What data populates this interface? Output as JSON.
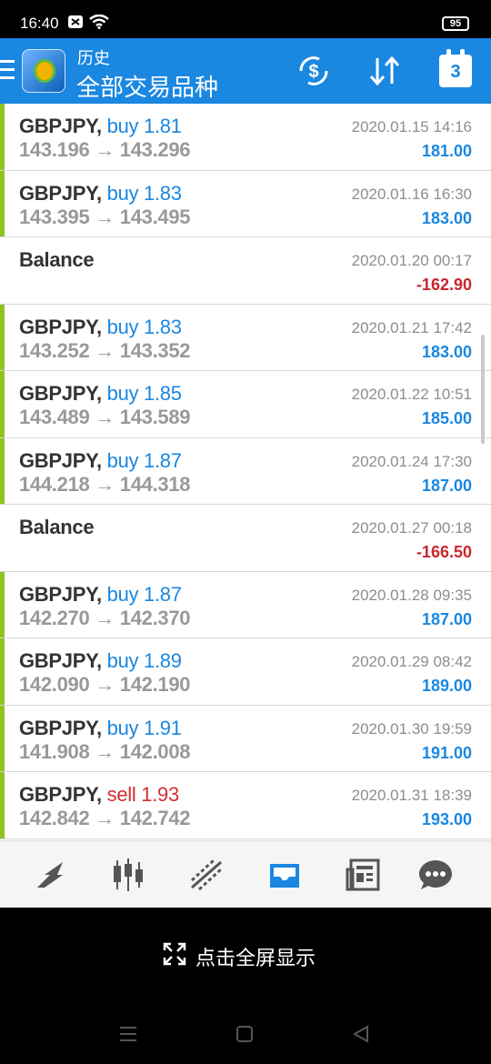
{
  "status_bar": {
    "time": "16:40",
    "battery": "95"
  },
  "header": {
    "subtitle": "历史",
    "title": "全部交易品种",
    "calendar_day": "3"
  },
  "rows": [
    {
      "type": "trade",
      "symbol": "GBPJPY,",
      "direction": "buy",
      "volume": "1.81",
      "price_open": "143.196",
      "arrow": "→",
      "price_close": "143.296",
      "datetime": "2020.01.15 14:16",
      "profit": "181.00"
    },
    {
      "type": "trade",
      "symbol": "GBPJPY,",
      "direction": "buy",
      "volume": "1.83",
      "price_open": "143.395",
      "arrow": "→",
      "price_close": "143.495",
      "datetime": "2020.01.16 16:30",
      "profit": "183.00"
    },
    {
      "type": "balance",
      "label": "Balance",
      "datetime": "2020.01.20 00:17",
      "profit": "-162.90"
    },
    {
      "type": "trade",
      "symbol": "GBPJPY,",
      "direction": "buy",
      "volume": "1.83",
      "price_open": "143.252",
      "arrow": "→",
      "price_close": "143.352",
      "datetime": "2020.01.21 17:42",
      "profit": "183.00"
    },
    {
      "type": "trade",
      "symbol": "GBPJPY,",
      "direction": "buy",
      "volume": "1.85",
      "price_open": "143.489",
      "arrow": "→",
      "price_close": "143.589",
      "datetime": "2020.01.22 10:51",
      "profit": "185.00"
    },
    {
      "type": "trade",
      "symbol": "GBPJPY,",
      "direction": "buy",
      "volume": "1.87",
      "price_open": "144.218",
      "arrow": "→",
      "price_close": "144.318",
      "datetime": "2020.01.24 17:30",
      "profit": "187.00"
    },
    {
      "type": "balance",
      "label": "Balance",
      "datetime": "2020.01.27 00:18",
      "profit": "-166.50"
    },
    {
      "type": "trade",
      "symbol": "GBPJPY,",
      "direction": "buy",
      "volume": "1.87",
      "price_open": "142.270",
      "arrow": "→",
      "price_close": "142.370",
      "datetime": "2020.01.28 09:35",
      "profit": "187.00"
    },
    {
      "type": "trade",
      "symbol": "GBPJPY,",
      "direction": "buy",
      "volume": "1.89",
      "price_open": "142.090",
      "arrow": "→",
      "price_close": "142.190",
      "datetime": "2020.01.29 08:42",
      "profit": "189.00"
    },
    {
      "type": "trade",
      "symbol": "GBPJPY,",
      "direction": "buy",
      "volume": "1.91",
      "price_open": "141.908",
      "arrow": "→",
      "price_close": "142.008",
      "datetime": "2020.01.30 19:59",
      "profit": "191.00"
    },
    {
      "type": "trade",
      "symbol": "GBPJPY,",
      "direction": "sell",
      "volume": "1.93",
      "price_open": "142.842",
      "arrow": "→",
      "price_close": "142.742",
      "datetime": "2020.01.31 18:39",
      "profit": "193.00"
    }
  ],
  "bottom_nav": [
    {
      "icon": "quotes-icon"
    },
    {
      "icon": "chart-icon"
    },
    {
      "icon": "trade-icon"
    },
    {
      "icon": "history-icon",
      "active": true
    },
    {
      "icon": "news-icon"
    },
    {
      "icon": "chat-icon"
    }
  ],
  "fullscreen": {
    "label": "点击全屏显示"
  },
  "colors": {
    "accent": "#1a87e0",
    "buy_bar": "#8fc31f",
    "sell": "#d32f2f",
    "negative": "#c8272d"
  }
}
